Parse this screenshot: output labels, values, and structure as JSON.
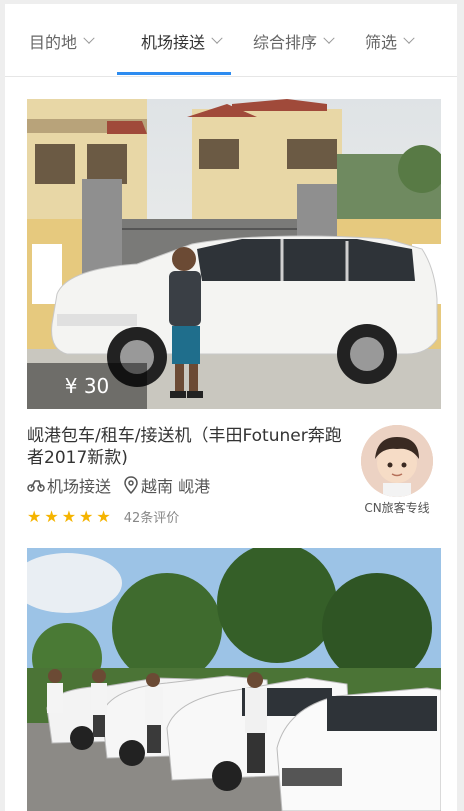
{
  "tabs": [
    {
      "label": "目的地"
    },
    {
      "label": "机场接送"
    },
    {
      "label": "综合排序"
    },
    {
      "label": "筛选"
    }
  ],
  "cards": [
    {
      "price": "¥ 30",
      "title": "岘港包车/租车/接送机（丰田Fotuner奔跑者2017新款)",
      "service": "机场接送",
      "location": "越南 岘港",
      "rating": 5,
      "reviews": "42条评价",
      "shop_name": "CN旅客专线"
    },
    {
      "price": ""
    }
  ]
}
